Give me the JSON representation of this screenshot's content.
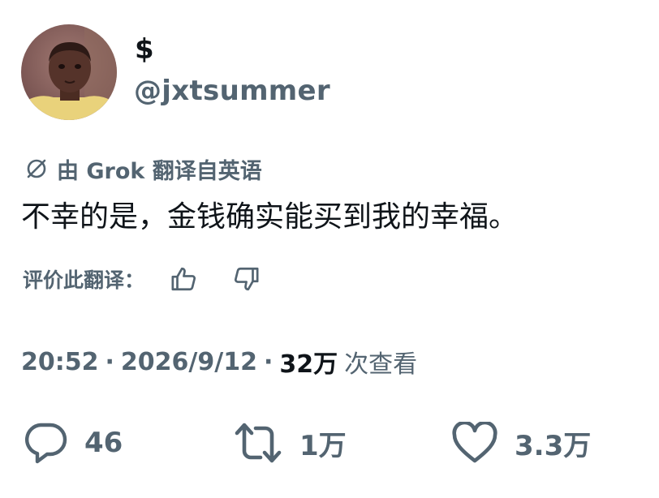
{
  "author": {
    "display_name": "$",
    "handle": "@jxtsummer"
  },
  "translation": {
    "notice": "由 Grok 翻译自英语",
    "icon": "translate-icon",
    "rate_label": "评价此翻译："
  },
  "tweet": {
    "text": "不幸的是，金钱确实能买到我的幸福。"
  },
  "meta": {
    "time": "20:52",
    "date": "2026/9/12",
    "separator": "·",
    "views_count": "32万",
    "views_label": "次查看"
  },
  "actions": {
    "replies": "46",
    "reposts": "1万",
    "likes": "3.3万"
  },
  "colors": {
    "text_primary": "#0f1419",
    "text_secondary": "#536471",
    "background": "#ffffff"
  }
}
